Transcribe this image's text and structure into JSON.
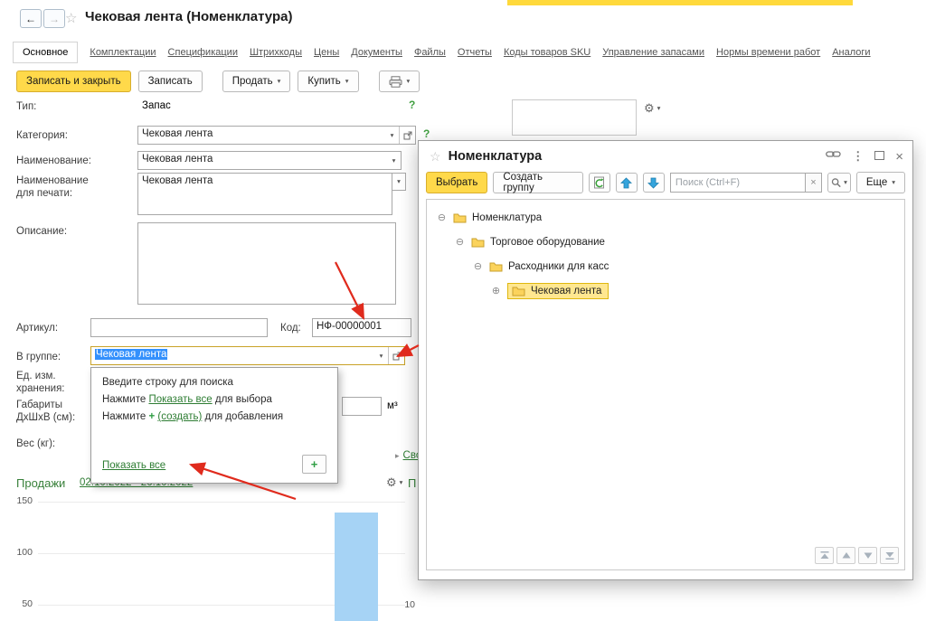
{
  "window": {
    "title": "Чековая лента (Номенклатура)"
  },
  "icons": {
    "back": "←",
    "forward": "→",
    "star": "☆",
    "caret": "▾",
    "help": "?",
    "dots": "⋮",
    "close": "×",
    "gear": "⚙",
    "collapsed": "⊖",
    "expanded": "⊕",
    "plus": "+",
    "marker": "▸",
    "clear": "×"
  },
  "tabs": [
    "Основное",
    "Комплектации",
    "Спецификации",
    "Штрихкоды",
    "Цены",
    "Документы",
    "Файлы",
    "Отчеты",
    "Коды товаров SKU",
    "Управление запасами",
    "Нормы времени работ",
    "Аналоги"
  ],
  "commands": {
    "save_close": "Записать и закрыть",
    "save": "Записать",
    "sell": "Продать",
    "buy": "Купить"
  },
  "form": {
    "type_label": "Тип:",
    "type_value": "Запас",
    "category_label": "Категория:",
    "category_value": "Чековая лента",
    "name_label": "Наименование:",
    "name_value": "Чековая лента",
    "print_name_label": "Наименование для печати:",
    "print_name_value": "Чековая лента",
    "description_label": "Описание:",
    "description_value": "",
    "article_label": "Артикул:",
    "article_value": "",
    "code_label": "Код:",
    "code_value": "НФ-00000001",
    "group_label": "В группе:",
    "group_value": "Чековая лента",
    "unit_label": "Ед. изм. хранения:",
    "dimensions_label": "Габариты ДхШхВ (см):",
    "dimensions_suffix": "м³",
    "weight_label": "Вес (кг):",
    "custom_attr_label": "Свой реквизит"
  },
  "quick_choice": {
    "hint_search": "Введите строку для поиска",
    "hint_show_prefix": "Нажмите ",
    "hint_show_link": "Показать все",
    "hint_show_suffix": " для выбора",
    "hint_create_prefix": "Нажмите ",
    "hint_create_plus": "+",
    "hint_create_link": "(создать)",
    "hint_create_suffix": " для добавления",
    "show_all_link": "Показать все"
  },
  "sales": {
    "title": "Продажи",
    "period": "02.10.2022 - 26.10.2022",
    "y_ticks": [
      "150",
      "100",
      "50"
    ]
  },
  "purchases": {
    "title_partial": "П",
    "y_tick": "10"
  },
  "modal": {
    "title": "Номенклатура",
    "select_button": "Выбрать",
    "create_group_button": "Создать группу",
    "search_placeholder": "Поиск (Ctrl+F)",
    "more_button": "Еще",
    "tree": [
      {
        "label": "Номенклатура"
      },
      {
        "label": "Торговое оборудование"
      },
      {
        "label": "Расходники для касс"
      },
      {
        "label": "Чековая лента"
      }
    ]
  },
  "chart_data": [
    {
      "type": "bar",
      "title": "Продажи",
      "period": "02.10.2022 - 26.10.2022",
      "y_ticks": [
        150,
        100,
        50
      ],
      "values": [
        145
      ],
      "bar_color": "#a6d3f5",
      "note": "single bar visible, chart cropped at bottom edge of screenshot"
    },
    {
      "type": "bar",
      "title_partial": "П",
      "y_ticks": [
        10
      ],
      "values": [],
      "note": "second chart almost fully hidden behind modal window"
    }
  ],
  "colors": {
    "primary_button": "#ffd94a",
    "selection": "#3390fc",
    "link_green": "#2e7d33",
    "bar_blue": "#a6d3f5",
    "annotation_red": "#e02b1d",
    "tree_highlight": "#ffe790",
    "window_strip": "#ffd93b"
  }
}
